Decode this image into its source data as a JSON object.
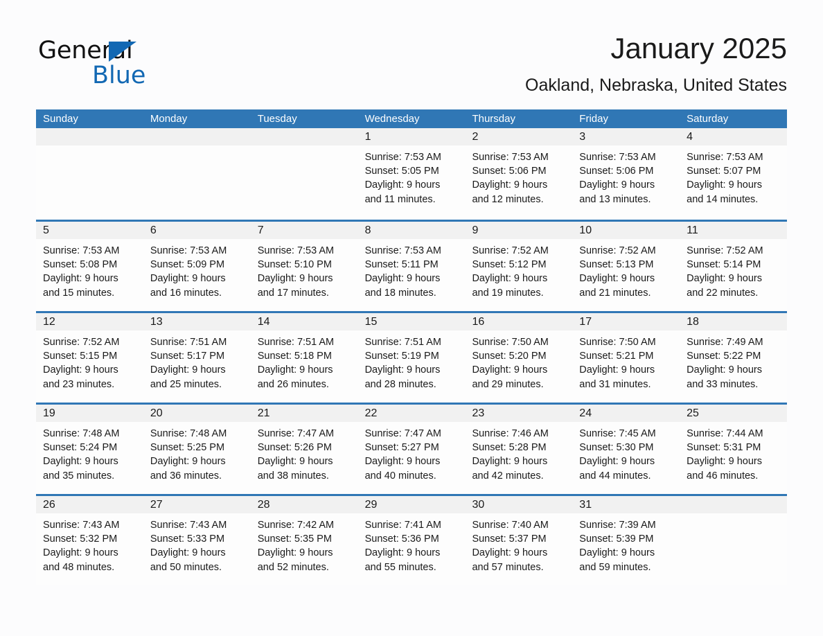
{
  "brand": {
    "name_part1": "General",
    "name_part2": "Blue",
    "logo_icon": "triangle-flag-icon",
    "accent_color": "#1268b3"
  },
  "header": {
    "title": "January 2025",
    "subtitle": "Oakland, Nebraska, United States"
  },
  "calendar": {
    "header_bg": "#3077b5",
    "daynum_bg": "#f1f1f1",
    "weekdays": [
      "Sunday",
      "Monday",
      "Tuesday",
      "Wednesday",
      "Thursday",
      "Friday",
      "Saturday"
    ],
    "weeks": [
      [
        {
          "day": "",
          "empty": true
        },
        {
          "day": "",
          "empty": true
        },
        {
          "day": "",
          "empty": true
        },
        {
          "day": "1",
          "sunrise": "Sunrise: 7:53 AM",
          "sunset": "Sunset: 5:05 PM",
          "daylight_line1": "Daylight: 9 hours",
          "daylight_line2": "and 11 minutes."
        },
        {
          "day": "2",
          "sunrise": "Sunrise: 7:53 AM",
          "sunset": "Sunset: 5:06 PM",
          "daylight_line1": "Daylight: 9 hours",
          "daylight_line2": "and 12 minutes."
        },
        {
          "day": "3",
          "sunrise": "Sunrise: 7:53 AM",
          "sunset": "Sunset: 5:06 PM",
          "daylight_line1": "Daylight: 9 hours",
          "daylight_line2": "and 13 minutes."
        },
        {
          "day": "4",
          "sunrise": "Sunrise: 7:53 AM",
          "sunset": "Sunset: 5:07 PM",
          "daylight_line1": "Daylight: 9 hours",
          "daylight_line2": "and 14 minutes."
        }
      ],
      [
        {
          "day": "5",
          "sunrise": "Sunrise: 7:53 AM",
          "sunset": "Sunset: 5:08 PM",
          "daylight_line1": "Daylight: 9 hours",
          "daylight_line2": "and 15 minutes."
        },
        {
          "day": "6",
          "sunrise": "Sunrise: 7:53 AM",
          "sunset": "Sunset: 5:09 PM",
          "daylight_line1": "Daylight: 9 hours",
          "daylight_line2": "and 16 minutes."
        },
        {
          "day": "7",
          "sunrise": "Sunrise: 7:53 AM",
          "sunset": "Sunset: 5:10 PM",
          "daylight_line1": "Daylight: 9 hours",
          "daylight_line2": "and 17 minutes."
        },
        {
          "day": "8",
          "sunrise": "Sunrise: 7:53 AM",
          "sunset": "Sunset: 5:11 PM",
          "daylight_line1": "Daylight: 9 hours",
          "daylight_line2": "and 18 minutes."
        },
        {
          "day": "9",
          "sunrise": "Sunrise: 7:52 AM",
          "sunset": "Sunset: 5:12 PM",
          "daylight_line1": "Daylight: 9 hours",
          "daylight_line2": "and 19 minutes."
        },
        {
          "day": "10",
          "sunrise": "Sunrise: 7:52 AM",
          "sunset": "Sunset: 5:13 PM",
          "daylight_line1": "Daylight: 9 hours",
          "daylight_line2": "and 21 minutes."
        },
        {
          "day": "11",
          "sunrise": "Sunrise: 7:52 AM",
          "sunset": "Sunset: 5:14 PM",
          "daylight_line1": "Daylight: 9 hours",
          "daylight_line2": "and 22 minutes."
        }
      ],
      [
        {
          "day": "12",
          "sunrise": "Sunrise: 7:52 AM",
          "sunset": "Sunset: 5:15 PM",
          "daylight_line1": "Daylight: 9 hours",
          "daylight_line2": "and 23 minutes."
        },
        {
          "day": "13",
          "sunrise": "Sunrise: 7:51 AM",
          "sunset": "Sunset: 5:17 PM",
          "daylight_line1": "Daylight: 9 hours",
          "daylight_line2": "and 25 minutes."
        },
        {
          "day": "14",
          "sunrise": "Sunrise: 7:51 AM",
          "sunset": "Sunset: 5:18 PM",
          "daylight_line1": "Daylight: 9 hours",
          "daylight_line2": "and 26 minutes."
        },
        {
          "day": "15",
          "sunrise": "Sunrise: 7:51 AM",
          "sunset": "Sunset: 5:19 PM",
          "daylight_line1": "Daylight: 9 hours",
          "daylight_line2": "and 28 minutes."
        },
        {
          "day": "16",
          "sunrise": "Sunrise: 7:50 AM",
          "sunset": "Sunset: 5:20 PM",
          "daylight_line1": "Daylight: 9 hours",
          "daylight_line2": "and 29 minutes."
        },
        {
          "day": "17",
          "sunrise": "Sunrise: 7:50 AM",
          "sunset": "Sunset: 5:21 PM",
          "daylight_line1": "Daylight: 9 hours",
          "daylight_line2": "and 31 minutes."
        },
        {
          "day": "18",
          "sunrise": "Sunrise: 7:49 AM",
          "sunset": "Sunset: 5:22 PM",
          "daylight_line1": "Daylight: 9 hours",
          "daylight_line2": "and 33 minutes."
        }
      ],
      [
        {
          "day": "19",
          "sunrise": "Sunrise: 7:48 AM",
          "sunset": "Sunset: 5:24 PM",
          "daylight_line1": "Daylight: 9 hours",
          "daylight_line2": "and 35 minutes."
        },
        {
          "day": "20",
          "sunrise": "Sunrise: 7:48 AM",
          "sunset": "Sunset: 5:25 PM",
          "daylight_line1": "Daylight: 9 hours",
          "daylight_line2": "and 36 minutes."
        },
        {
          "day": "21",
          "sunrise": "Sunrise: 7:47 AM",
          "sunset": "Sunset: 5:26 PM",
          "daylight_line1": "Daylight: 9 hours",
          "daylight_line2": "and 38 minutes."
        },
        {
          "day": "22",
          "sunrise": "Sunrise: 7:47 AM",
          "sunset": "Sunset: 5:27 PM",
          "daylight_line1": "Daylight: 9 hours",
          "daylight_line2": "and 40 minutes."
        },
        {
          "day": "23",
          "sunrise": "Sunrise: 7:46 AM",
          "sunset": "Sunset: 5:28 PM",
          "daylight_line1": "Daylight: 9 hours",
          "daylight_line2": "and 42 minutes."
        },
        {
          "day": "24",
          "sunrise": "Sunrise: 7:45 AM",
          "sunset": "Sunset: 5:30 PM",
          "daylight_line1": "Daylight: 9 hours",
          "daylight_line2": "and 44 minutes."
        },
        {
          "day": "25",
          "sunrise": "Sunrise: 7:44 AM",
          "sunset": "Sunset: 5:31 PM",
          "daylight_line1": "Daylight: 9 hours",
          "daylight_line2": "and 46 minutes."
        }
      ],
      [
        {
          "day": "26",
          "sunrise": "Sunrise: 7:43 AM",
          "sunset": "Sunset: 5:32 PM",
          "daylight_line1": "Daylight: 9 hours",
          "daylight_line2": "and 48 minutes."
        },
        {
          "day": "27",
          "sunrise": "Sunrise: 7:43 AM",
          "sunset": "Sunset: 5:33 PM",
          "daylight_line1": "Daylight: 9 hours",
          "daylight_line2": "and 50 minutes."
        },
        {
          "day": "28",
          "sunrise": "Sunrise: 7:42 AM",
          "sunset": "Sunset: 5:35 PM",
          "daylight_line1": "Daylight: 9 hours",
          "daylight_line2": "and 52 minutes."
        },
        {
          "day": "29",
          "sunrise": "Sunrise: 7:41 AM",
          "sunset": "Sunset: 5:36 PM",
          "daylight_line1": "Daylight: 9 hours",
          "daylight_line2": "and 55 minutes."
        },
        {
          "day": "30",
          "sunrise": "Sunrise: 7:40 AM",
          "sunset": "Sunset: 5:37 PM",
          "daylight_line1": "Daylight: 9 hours",
          "daylight_line2": "and 57 minutes."
        },
        {
          "day": "31",
          "sunrise": "Sunrise: 7:39 AM",
          "sunset": "Sunset: 5:39 PM",
          "daylight_line1": "Daylight: 9 hours",
          "daylight_line2": "and 59 minutes."
        },
        {
          "day": "",
          "empty": true
        }
      ]
    ]
  }
}
